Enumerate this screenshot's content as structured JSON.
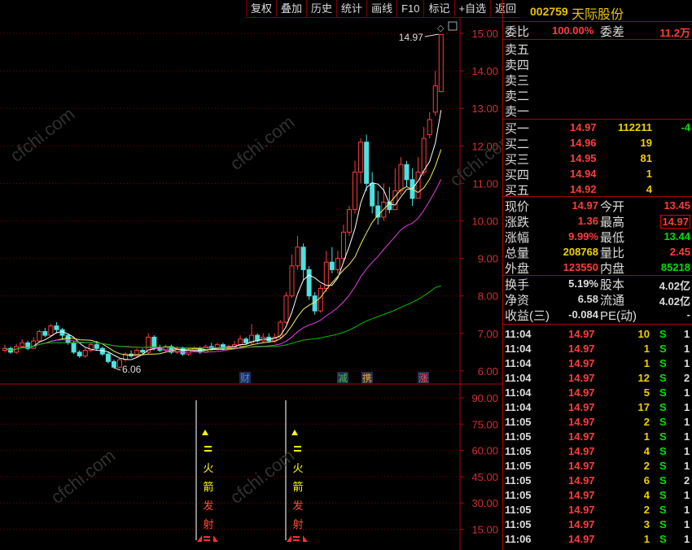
{
  "toolbar": [
    "复权",
    "叠加",
    "历史",
    "统计",
    "画线",
    "F10",
    "标记",
    "+自选",
    "返回"
  ],
  "stock": {
    "code": "002759",
    "name": "天际股份"
  },
  "weibi": {
    "label1": "委比",
    "val1": "100.00%",
    "label2": "委差",
    "val2": "11.2万"
  },
  "sell": [
    {
      "label": "卖五"
    },
    {
      "label": "卖四"
    },
    {
      "label": "卖三"
    },
    {
      "label": "卖二"
    },
    {
      "label": "卖一"
    }
  ],
  "buy": [
    {
      "label": "买一",
      "price": "14.97",
      "vol": "112211",
      "chg": "-4"
    },
    {
      "label": "买二",
      "price": "14.96",
      "vol": "19",
      "chg": ""
    },
    {
      "label": "买三",
      "price": "14.95",
      "vol": "81",
      "chg": ""
    },
    {
      "label": "买四",
      "price": "14.94",
      "vol": "1",
      "chg": ""
    },
    {
      "label": "买五",
      "price": "14.92",
      "vol": "4",
      "chg": ""
    }
  ],
  "quote": [
    {
      "l1": "现价",
      "v1": "14.97",
      "l2": "今开",
      "v2": "13.45"
    },
    {
      "l1": "涨跌",
      "v1": "1.36",
      "l2": "最高",
      "v2": "14.97"
    },
    {
      "l1": "涨幅",
      "v1": "9.99%",
      "l2": "最低",
      "v2": "13.44"
    },
    {
      "l1": "总量",
      "v1": "208768",
      "l2": "量比",
      "v2": "2.45"
    },
    {
      "l1": "外盘",
      "v1": "123550",
      "l2": "内盘",
      "v2": "85218"
    }
  ],
  "fin": [
    {
      "l1": "换手",
      "v1": "5.19%",
      "l2": "股本",
      "v2": "4.02亿"
    },
    {
      "l1": "净资",
      "v1": "6.58",
      "l2": "流通",
      "v2": "4.02亿"
    },
    {
      "l1": "收益(三)",
      "v1": "-0.084",
      "l2": "PE(动)",
      "v2": "-"
    }
  ],
  "ticks": [
    {
      "t": "11:04",
      "p": "14.97",
      "v": "10",
      "s": "S",
      "n": "1"
    },
    {
      "t": "11:04",
      "p": "14.97",
      "v": "1",
      "s": "S",
      "n": "1"
    },
    {
      "t": "11:04",
      "p": "14.97",
      "v": "1",
      "s": "S",
      "n": "1"
    },
    {
      "t": "11:04",
      "p": "14.97",
      "v": "12",
      "s": "S",
      "n": "2"
    },
    {
      "t": "11:04",
      "p": "14.97",
      "v": "5",
      "s": "S",
      "n": "1"
    },
    {
      "t": "11:04",
      "p": "14.97",
      "v": "17",
      "s": "S",
      "n": "1"
    },
    {
      "t": "11:05",
      "p": "14.97",
      "v": "2",
      "s": "S",
      "n": "1"
    },
    {
      "t": "11:05",
      "p": "14.97",
      "v": "1",
      "s": "S",
      "n": "1"
    },
    {
      "t": "11:05",
      "p": "14.97",
      "v": "4",
      "s": "S",
      "n": "1"
    },
    {
      "t": "11:05",
      "p": "14.97",
      "v": "2",
      "s": "S",
      "n": "1"
    },
    {
      "t": "11:05",
      "p": "14.97",
      "v": "6",
      "s": "S",
      "n": "2"
    },
    {
      "t": "11:05",
      "p": "14.97",
      "v": "4",
      "s": "S",
      "n": "1"
    },
    {
      "t": "11:05",
      "p": "14.97",
      "v": "2",
      "s": "S",
      "n": "1"
    },
    {
      "t": "11:05",
      "p": "14.97",
      "v": "3",
      "s": "S",
      "n": "1"
    },
    {
      "t": "11:06",
      "p": "14.97",
      "v": "1",
      "s": "S",
      "n": "1"
    }
  ],
  "chart": {
    "price_axis": [
      "15.00",
      "14.00",
      "13.00",
      "12.00",
      "11.00",
      "10.00",
      "9.00",
      "8.00",
      "7.00",
      "6.00"
    ],
    "ind_axis": [
      "90.00",
      "75.00",
      "60.00",
      "45.00",
      "30.00",
      "15.00"
    ],
    "high_label": "14.97",
    "low_label": "6.06",
    "markers": [
      "财",
      "减",
      "携",
      "涨"
    ],
    "signal_text": [
      "火",
      "箭",
      "发",
      "射"
    ]
  },
  "watermark": "cfchi.com"
}
